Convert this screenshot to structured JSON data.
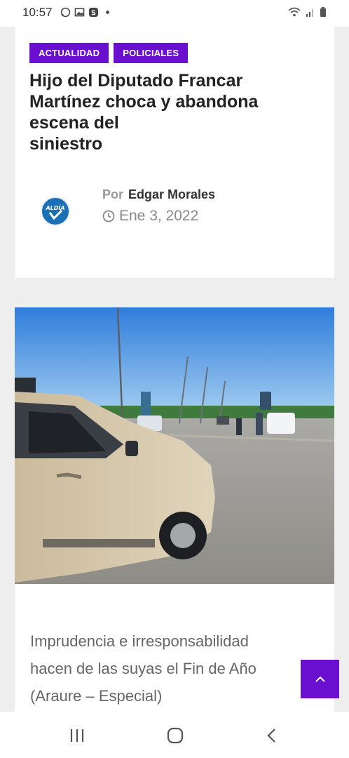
{
  "status_bar": {
    "time": "10:57",
    "left_icons": [
      "whatsapp-icon",
      "image-icon",
      "app-s-icon",
      "dot-icon"
    ],
    "right_icons": [
      "wifi-icon",
      "signal-icon",
      "battery-icon"
    ]
  },
  "article": {
    "tags": [
      "ACTUALIDAD",
      "POLICIALES"
    ],
    "title_lines": [
      "Hijo del Diputado Francar",
      "Martínez choca y abandona",
      "escena del",
      "siniestro"
    ],
    "by_label": "Por",
    "author": "Edgar Morales",
    "date": "Ene 3, 2022",
    "avatar_text": "ALDÍA",
    "excerpt_lines": [
      "Imprudencia e irresponsabilidad",
      "hacen de las suyas el Fin de Año",
      "(Araure – Especial)"
    ]
  },
  "colors": {
    "accent": "#6a0fd0",
    "background": "#eeeeee",
    "card": "#ffffff"
  },
  "nav": {
    "icons": [
      "recent-apps-icon",
      "home-icon",
      "back-icon"
    ]
  }
}
